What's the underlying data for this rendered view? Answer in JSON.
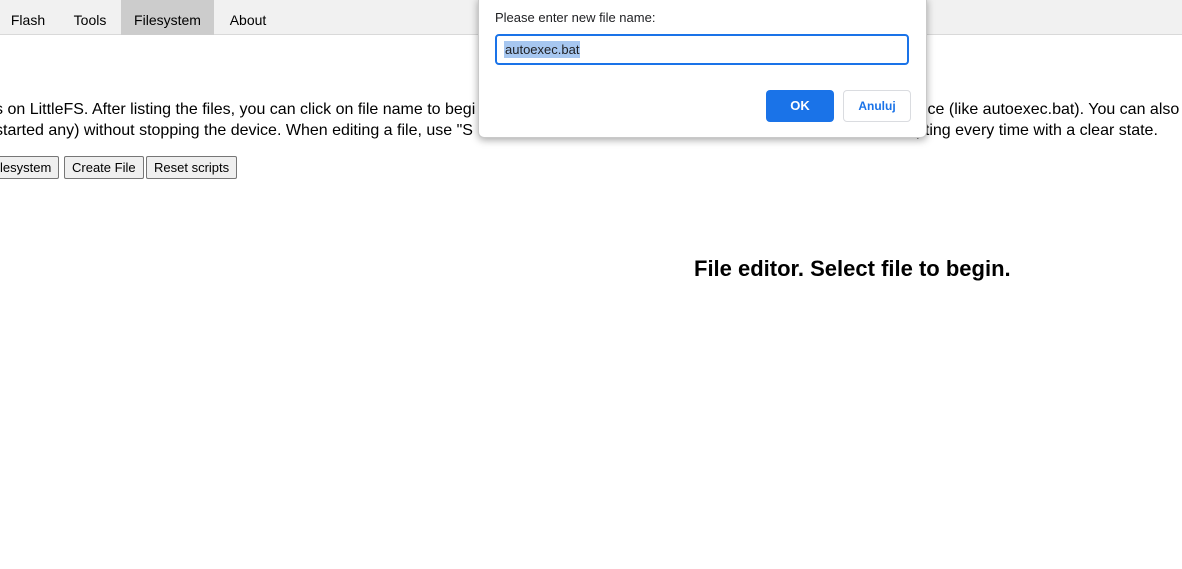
{
  "nav": {
    "tabs": [
      {
        "label": "Flash"
      },
      {
        "label": "Tools"
      },
      {
        "label": "Filesystem"
      },
      {
        "label": "About"
      }
    ],
    "active_tab": "Filesystem"
  },
  "description": {
    "line1_left": "s on LittleFS. After listing the files, you can click on file name to begi",
    "line1_right": "vice (like autoexec.bat). You can also",
    "line2_left": "started any) without stopping the device. When editing a file, use \"S",
    "line2_right": "pting every time with a clear state."
  },
  "toolbar": {
    "filesystem_button_partial": "lesystem",
    "create_file_button": "Create File",
    "reset_scripts_button": "Reset scripts"
  },
  "editor": {
    "placeholder_message": "File editor. Select file to begin."
  },
  "dialog": {
    "label": "Please enter new file name:",
    "input_value": "autoexec.bat",
    "ok_label": "OK",
    "cancel_label": "Anuluj"
  },
  "colors": {
    "accent": "#1a73e8",
    "topbar_bg": "#f1f1f1",
    "active_tab_bg": "#cccccc",
    "selection": "#a7c7f0"
  }
}
